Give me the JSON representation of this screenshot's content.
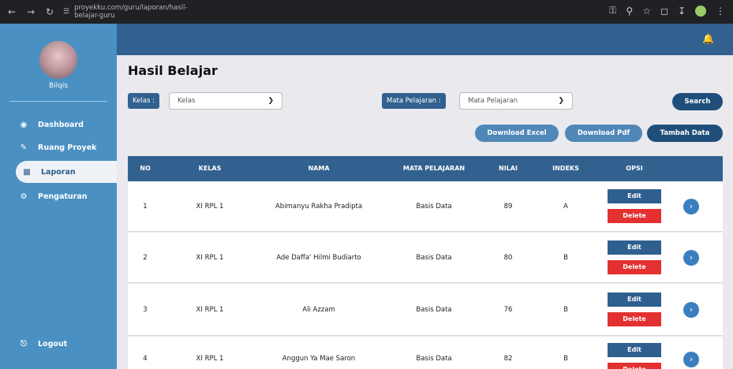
{
  "browser": {
    "url": "proyekku.com/guru/laporan/hasil-belajar-guru"
  },
  "sidebar": {
    "username": "Bilqis",
    "items": [
      {
        "label": "Dashboard",
        "icon": "palette-icon"
      },
      {
        "label": "Ruang Proyek",
        "icon": "document-icon"
      },
      {
        "label": "Laporan",
        "icon": "report-chart-icon"
      },
      {
        "label": "Pengaturan",
        "icon": "gear-icon"
      }
    ],
    "logout_label": "Logout"
  },
  "page": {
    "title": "Hasil Belajar",
    "kelas_label": "Kelas :",
    "kelas_placeholder": "Kelas",
    "mapel_label": "Mata Pelajaran :",
    "mapel_placeholder": "Mata Pelajaran",
    "search_label": "Search",
    "download_excel_label": "Download Excel",
    "download_pdf_label": "Download Pdf",
    "tambah_label": "Tambah Data"
  },
  "table": {
    "headers": [
      "NO",
      "KELAS",
      "NAMA",
      "MATA PELAJARAN",
      "NILAI",
      "INDEKS",
      "OPSI"
    ],
    "edit_label": "Edit",
    "delete_label": "Delete",
    "rows": [
      {
        "no": "1",
        "kelas": "XI RPL 1",
        "nama": "Abimanyu Rakha Pradipta",
        "mapel": "Basis Data",
        "nilai": "89",
        "indeks": "A"
      },
      {
        "no": "2",
        "kelas": "XI RPL 1",
        "nama": "Ade Daffa' Hilmi Budiarto",
        "mapel": "Basis Data",
        "nilai": "80",
        "indeks": "B"
      },
      {
        "no": "3",
        "kelas": "XI RPL 1",
        "nama": "Ali Azzam",
        "mapel": "Basis Data",
        "nilai": "76",
        "indeks": "B"
      },
      {
        "no": "4",
        "kelas": "XI RPL 1",
        "nama": "Anggun Ya Mae Saron",
        "mapel": "Basis Data",
        "nilai": "82",
        "indeks": "B"
      }
    ]
  }
}
